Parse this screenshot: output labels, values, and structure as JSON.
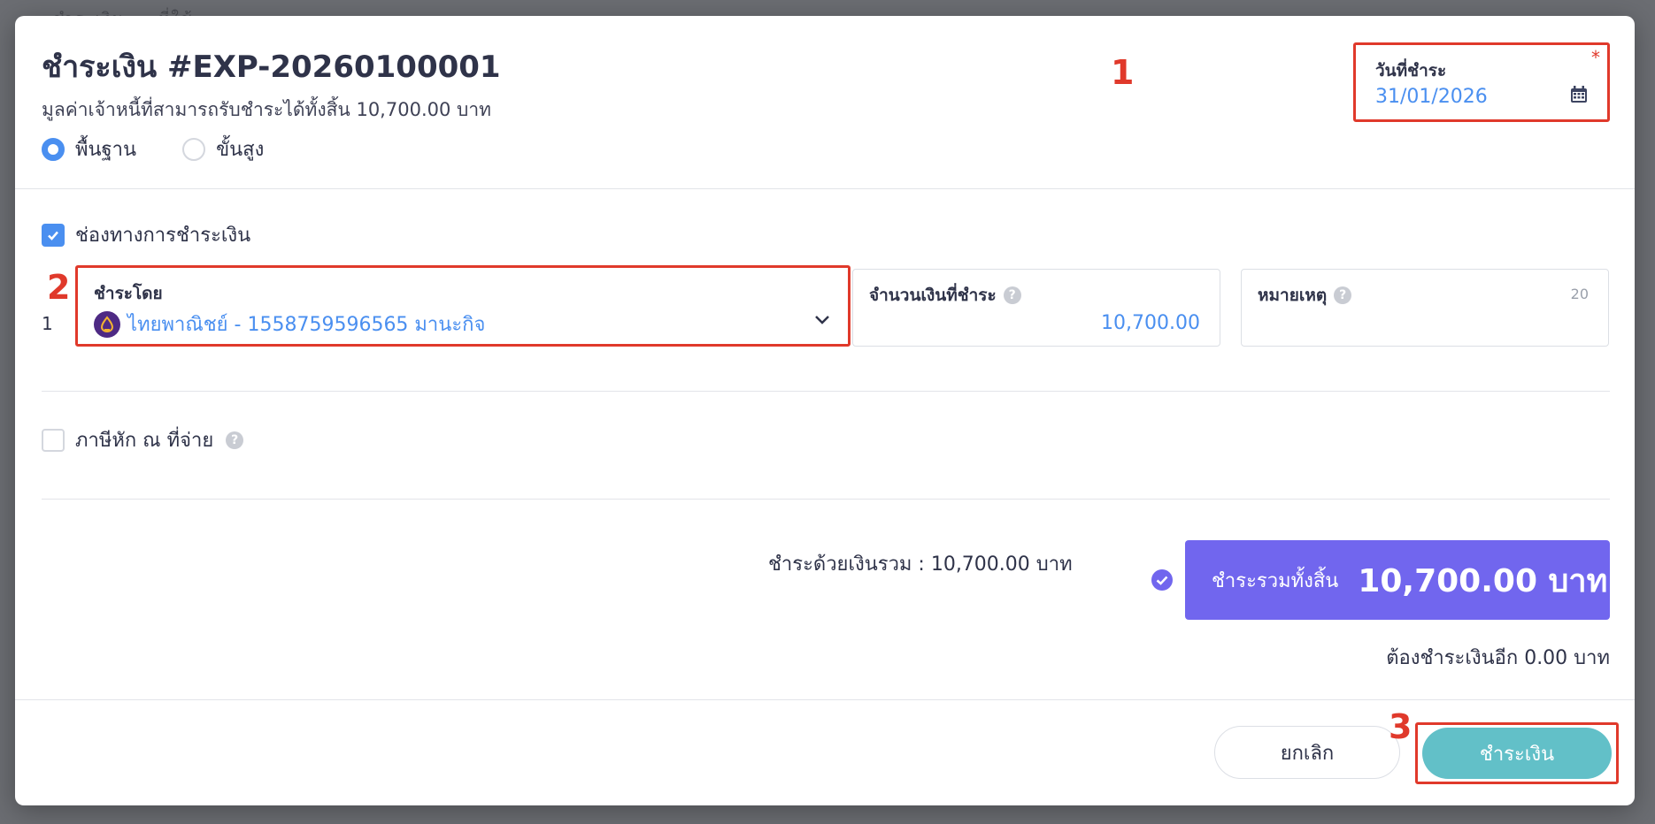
{
  "backdrop": {
    "text": "ชำระเงิน ... ที่ใช้"
  },
  "modal": {
    "title": "ชำระเงิน #EXP-20260100001",
    "subtitle": "มูลค่าเจ้าหนี้ที่สามารถรับชำระได้ทั้งสิ้น 10,700.00 บาท",
    "mode_options": [
      {
        "label": "พื้นฐาน",
        "selected": true
      },
      {
        "label": "ขั้นสูง",
        "selected": false
      }
    ],
    "payment_date": {
      "label": "วันที่ชำระ",
      "value": "31/01/2026",
      "required_mark": "*",
      "icon": "calendar-icon"
    },
    "annotations": [
      "1",
      "2",
      "3"
    ],
    "payment_channel": {
      "checkbox_label": "ช่องทางการชำระเงิน",
      "checked": true,
      "row_number": "1",
      "pay_by": {
        "label": "ชำระโดย",
        "value": "ไทยพาณิชย์ - 1558759596565 มานะกิจ",
        "icon": "bank-logo-icon"
      },
      "amount": {
        "label": "จำนวนเงินที่ชำระ",
        "value": "10,700.00"
      },
      "note": {
        "label": "หมายเหตุ",
        "counter": "20"
      }
    },
    "withholding_tax": {
      "label": "ภาษีหัก ณ ที่จ่าย",
      "checked": false
    },
    "summary": {
      "paid_total_text": "ชำระด้วยเงินรวม :  10,700.00 บาท",
      "grand_total_label": "ชำระรวมทั้งสิ้น",
      "grand_total_amount": "10,700.00 บาท",
      "remaining_text": "ต้องชำระเงินอีก 0.00 บาท"
    },
    "buttons": {
      "cancel": "ยกเลิก",
      "pay": "ชำระเงิน"
    }
  },
  "colors": {
    "accent_blue": "#4a8ff0",
    "total_purple": "#7166ee",
    "pay_teal": "#62c0c8",
    "annotation_red": "#e0392b"
  }
}
